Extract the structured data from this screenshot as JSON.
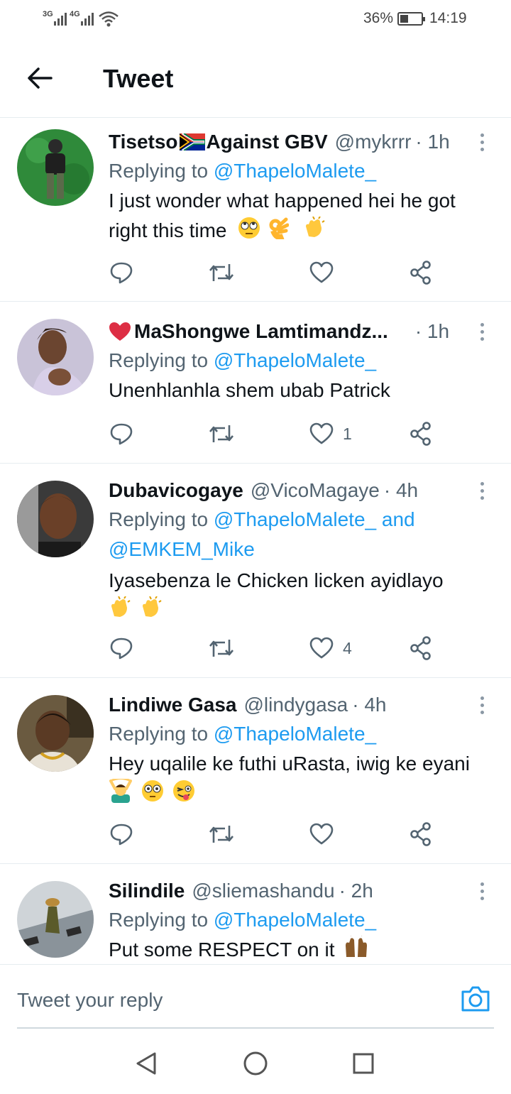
{
  "status_bar": {
    "signal_1": "3G",
    "signal_2": "4G",
    "battery": "36%",
    "time": "14:19",
    "icons": [
      "signal-icon",
      "wifi-icon",
      "battery-charging-icon"
    ]
  },
  "header": {
    "back_icon": "arrow-left-icon",
    "title": "Tweet"
  },
  "tweets": [
    {
      "name_pre": "Tisetso",
      "name_post": "Against GBV",
      "flag": "south-africa-flag",
      "handle": "@mykrrr",
      "time": "· 1h",
      "reply_prefix": "Replying to ",
      "mention": "@ThapeloMalete_",
      "text": "I just wonder what happened hei he got right this time",
      "emojis": [
        "eye-roll-emoji",
        "ok-hand-emoji",
        "clapping-hands-emoji"
      ],
      "likes": ""
    },
    {
      "name_pre": "",
      "name_post": "MaShongwe Lamtimandz...",
      "heart": "red-heart-emoji",
      "handle": "",
      "time": "· 1h",
      "reply_prefix": "Replying to ",
      "mention": "@ThapeloMalete_",
      "text": "Unenhlanhla shem ubab Patrick",
      "likes": "1"
    },
    {
      "name_post": "Dubavicogaye",
      "handle": "@VicoMagaye",
      "time": "· 4h",
      "reply_prefix": "Replying to ",
      "mention": "@ThapeloMalete_ and",
      "mention2": "@EMKEM_Mike",
      "text": "Iyasebenza le Chicken licken  ayidlayo",
      "emojis": [
        "clapping-hands-emoji",
        "clapping-hands-emoji"
      ],
      "likes": "4"
    },
    {
      "name_post": "Lindiwe Gasa",
      "handle": "@lindygasa",
      "time": "· 4h",
      "reply_prefix": "Replying to ",
      "mention": "@ThapeloMalete_",
      "text": "Hey uqalile ke futhi uRasta, iwig ke eyani",
      "emojis": [
        "person-gesturing-ok-emoji",
        "flushed-face-emoji",
        "winking-tongue-emoji"
      ],
      "likes": ""
    },
    {
      "name_post": "Silindile",
      "handle": "@sliemashandu",
      "time": "· 2h",
      "reply_prefix": "Replying to ",
      "mention": "@ThapeloMalete_",
      "text": "Put some RESPECT on it",
      "emojis": [
        "raising-hands-emoji"
      ]
    }
  ],
  "action_icons": [
    "reply-icon",
    "retweet-icon",
    "like-icon",
    "share-icon"
  ],
  "reply_bar": {
    "placeholder": "Tweet your reply",
    "camera_icon": "camera-icon"
  },
  "nav_bar": {
    "icons": [
      "back-triangle-icon",
      "home-circle-icon",
      "recents-square-icon"
    ]
  },
  "colors": {
    "accent": "#1d9bf0",
    "secondary_text": "#536471",
    "primary_text": "#0f1419",
    "divider": "#e6ecf0"
  }
}
